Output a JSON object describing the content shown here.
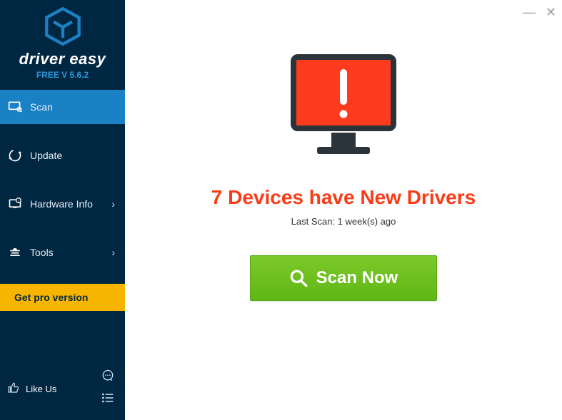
{
  "brand": {
    "name": "driver easy",
    "version": "FREE V 5.6.2"
  },
  "sidebar": {
    "items": [
      {
        "label": "Scan"
      },
      {
        "label": "Update"
      },
      {
        "label": "Hardware Info"
      },
      {
        "label": "Tools"
      }
    ],
    "getpro": "Get pro version",
    "like": "Like Us"
  },
  "main": {
    "headline": "7 Devices have New Drivers",
    "subline": "Last Scan: 1 week(s) ago",
    "scan_button": "Scan Now"
  },
  "colors": {
    "accent": "#1b81c5",
    "sidebar_bg": "#002742",
    "getpro_bg": "#f7b500",
    "alert_red": "#fa3b18",
    "monitor_red": "#ff3b1f",
    "scan_green": "#6bc11c"
  }
}
